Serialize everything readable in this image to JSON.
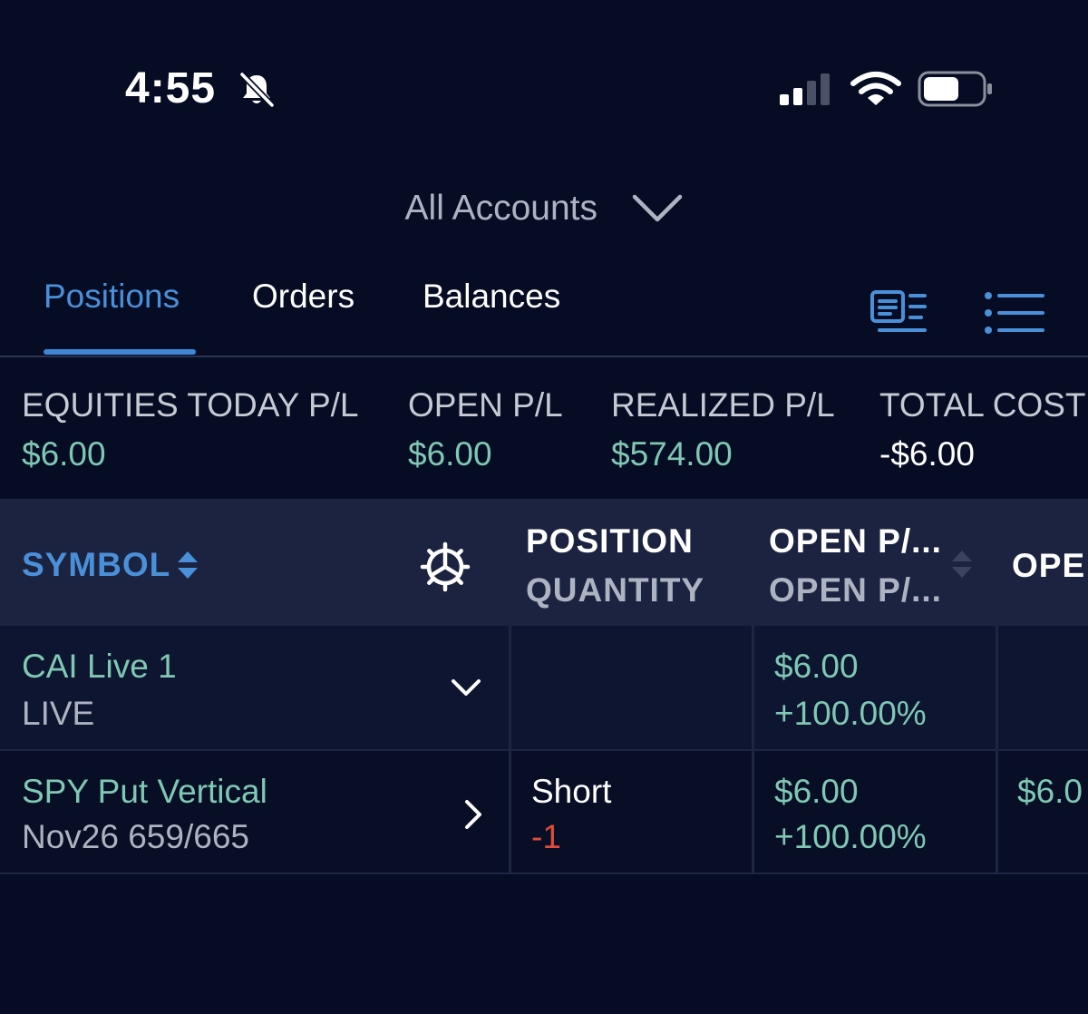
{
  "status_bar": {
    "time": "4:55",
    "icons": [
      "bell-slash-icon",
      "cellular-signal-icon",
      "wifi-icon",
      "battery-icon"
    ]
  },
  "account_selector": {
    "label": "All Accounts",
    "icon": "chevron-down-icon"
  },
  "tabs": [
    {
      "label": "Positions",
      "active": true
    },
    {
      "label": "Orders",
      "active": false
    },
    {
      "label": "Balances",
      "active": false
    }
  ],
  "view_toggle": {
    "icons": [
      "card-view-icon",
      "list-view-icon"
    ]
  },
  "summary": [
    {
      "label": "EQUITIES TODAY P/L",
      "value": "$6.00"
    },
    {
      "label": "OPEN P/L",
      "value": "$6.00"
    },
    {
      "label": "REALIZED P/L",
      "value": "$574.00"
    },
    {
      "label": "TOTAL COST",
      "value": "-$6.00"
    }
  ],
  "table": {
    "columns": {
      "symbol": "SYMBOL",
      "position_top": "POSITION",
      "position_sub": "QUANTITY",
      "openpl_top": "OPEN P/...",
      "openpl_sub": "OPEN P/...",
      "next_partial": "OPE"
    },
    "rows": [
      {
        "name": "CAI Live 1",
        "sub": "LIVE",
        "position": "",
        "quantity": "",
        "open_pl": "$6.00",
        "open_pl_pct": "+100.00%",
        "next_partial": ""
      },
      {
        "name": "SPY Put Vertical",
        "sub": "Nov26 659/665",
        "position": "Short",
        "quantity": "-1",
        "open_pl": "$6.00",
        "open_pl_pct": "+100.00%",
        "next_partial": "$6.0"
      }
    ]
  },
  "colors": {
    "background": "#050c23",
    "accent_blue": "#4a90d9",
    "positive_green": "#7fc8b4",
    "negative_red": "#e14b3b"
  }
}
